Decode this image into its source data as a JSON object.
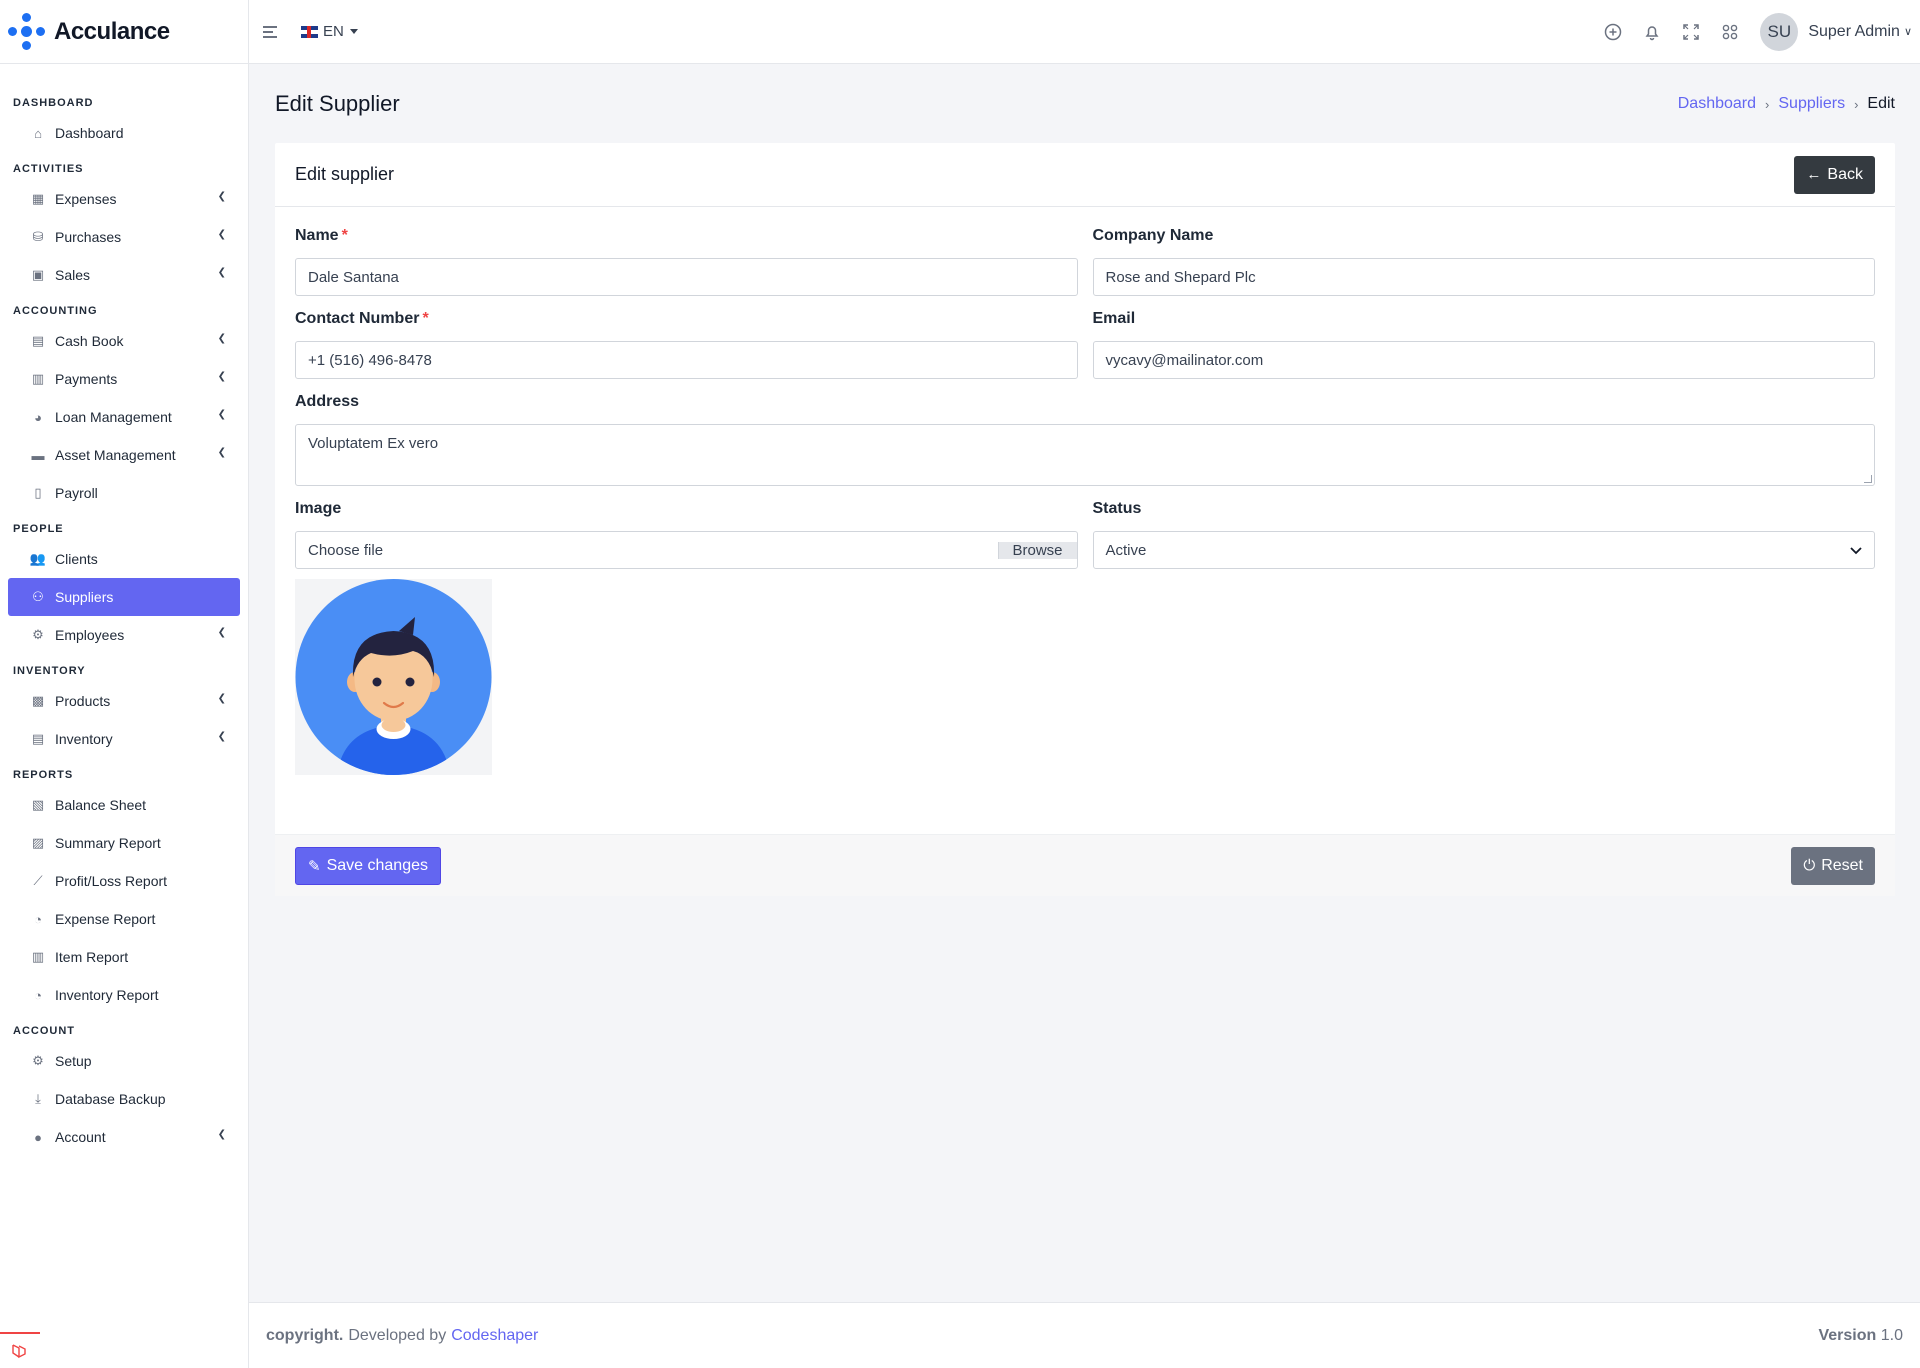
{
  "brand": {
    "name": "Acculance",
    "logo_icon": "acculance-logo-icon",
    "accent": "#1d6ff2"
  },
  "topbar": {
    "menu_icon": "hamburger-icon",
    "language": "EN",
    "icons": [
      "plus-circle-icon",
      "bell-icon",
      "fullscreen-icon",
      "apps-grid-icon"
    ],
    "avatar_initials": "SU",
    "user_name": "Super Admin"
  },
  "sidebar": {
    "sections": [
      {
        "title": "DASHBOARD",
        "items": [
          {
            "label": "Dashboard",
            "icon": "home-icon",
            "expandable": false
          }
        ]
      },
      {
        "title": "ACTIVITIES",
        "items": [
          {
            "label": "Expenses",
            "icon": "calculator-icon",
            "expandable": true
          },
          {
            "label": "Purchases",
            "icon": "basket-icon",
            "expandable": true
          },
          {
            "label": "Sales",
            "icon": "shopping-bag-icon",
            "expandable": true
          }
        ]
      },
      {
        "title": "ACCOUNTING",
        "items": [
          {
            "label": "Cash Book",
            "icon": "book-icon",
            "expandable": true
          },
          {
            "label": "Payments",
            "icon": "receipt-icon",
            "expandable": true
          },
          {
            "label": "Loan Management",
            "icon": "piggy-bank-icon",
            "expandable": true
          },
          {
            "label": "Asset Management",
            "icon": "couch-icon",
            "expandable": true
          },
          {
            "label": "Payroll",
            "icon": "clipboard-icon",
            "expandable": false
          }
        ]
      },
      {
        "title": "PEOPLE",
        "items": [
          {
            "label": "Clients",
            "icon": "users-icon",
            "expandable": false
          },
          {
            "label": "Suppliers",
            "icon": "people-carry-icon",
            "expandable": false,
            "active": true
          },
          {
            "label": "Employees",
            "icon": "users-cog-icon",
            "expandable": true
          }
        ]
      },
      {
        "title": "INVENTORY",
        "items": [
          {
            "label": "Products",
            "icon": "boxes-icon",
            "expandable": true
          },
          {
            "label": "Inventory",
            "icon": "warehouse-icon",
            "expandable": true
          }
        ]
      },
      {
        "title": "REPORTS",
        "items": [
          {
            "label": "Balance Sheet",
            "icon": "file-invoice-icon",
            "expandable": false
          },
          {
            "label": "Summary Report",
            "icon": "file-alt-icon",
            "expandable": false
          },
          {
            "label": "Profit/Loss Report",
            "icon": "line-chart-icon",
            "expandable": false
          },
          {
            "label": "Expense Report",
            "icon": "pie-chart-icon",
            "expandable": false
          },
          {
            "label": "Item Report",
            "icon": "bar-chart-icon",
            "expandable": false
          },
          {
            "label": "Inventory Report",
            "icon": "pie-chart-icon",
            "expandable": false
          }
        ]
      },
      {
        "title": "ACCOUNT",
        "items": [
          {
            "label": "Setup",
            "icon": "cogs-icon",
            "expandable": false
          },
          {
            "label": "Database Backup",
            "icon": "download-icon",
            "expandable": false
          },
          {
            "label": "Account",
            "icon": "user-icon",
            "expandable": true
          }
        ]
      }
    ]
  },
  "page": {
    "title": "Edit Supplier",
    "breadcrumb": [
      "Dashboard",
      "Suppliers",
      "Edit"
    ]
  },
  "card": {
    "title": "Edit supplier",
    "back_label": "Back",
    "fields": {
      "name": {
        "label": "Name",
        "value": "Dale Santana",
        "required": true
      },
      "company": {
        "label": "Company Name",
        "value": "Rose and Shepard Plc"
      },
      "contact": {
        "label": "Contact Number",
        "value": "+1 (516) 496-8478",
        "required": true
      },
      "email": {
        "label": "Email",
        "value": "vycavy@mailinator.com"
      },
      "address": {
        "label": "Address",
        "value": "Voluptatem Ex vero"
      },
      "image": {
        "label": "Image",
        "placeholder": "Choose file",
        "browse_label": "Browse"
      },
      "status": {
        "label": "Status",
        "value": "Active"
      }
    },
    "save_label": "Save changes",
    "reset_label": "Reset"
  },
  "footer": {
    "copyright": "copyright.",
    "developed_by": "Developed by",
    "developer": "Codeshaper",
    "version_label": "Version",
    "version": "1.0"
  },
  "colors": {
    "accent": "#6366f1",
    "dark_button": "#343a40",
    "reset_button": "#6b7280",
    "required": "#ef4444"
  }
}
